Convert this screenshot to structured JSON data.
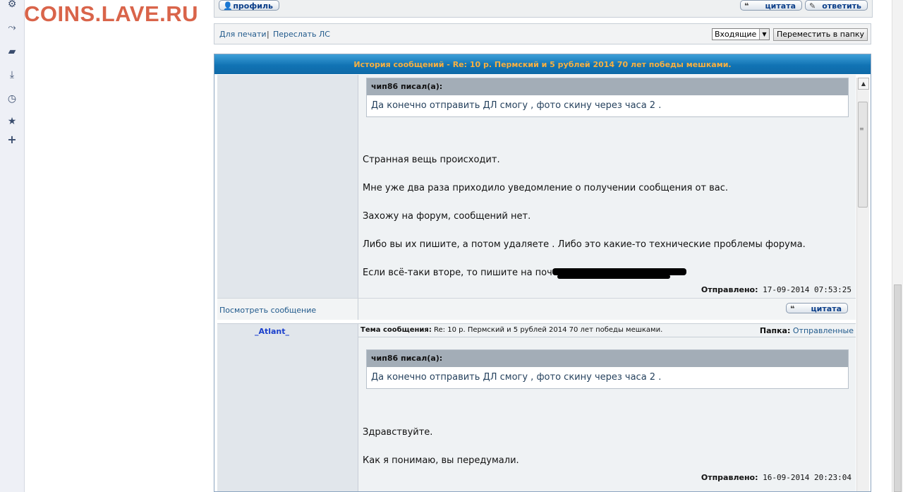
{
  "watermark": "COINS.LAVE.RU",
  "sidebar_icons": [
    "gear-icon",
    "share-icon",
    "note-icon",
    "download-icon",
    "clock-icon",
    "star-icon",
    "plus-icon"
  ],
  "top_buttons": {
    "profile": "профиль",
    "quote": "цитата",
    "reply": "ответить"
  },
  "toolbar": {
    "print_link": "Для печати",
    "separator": "|",
    "forward_link": "Переслать ЛС",
    "folder_select": "Входящие",
    "move_button": "Переместить в папку"
  },
  "history": {
    "title": "История сообщений - Re: 10 р. Пермский и 5 рублей 2014 70 лет победы мешками."
  },
  "message1": {
    "quote_header": "чип86 писал(а):",
    "quote_body": "Да конечно отправить ДЛ смогу , фото скину через часа 2 .",
    "lines": [
      "Странная вещь происходит.",
      "Мне уже два раза приходило уведомление о получении сообщения от вас.",
      "Захожу на форум, сообщений нет.",
      "Либо вы их пишите, а потом удаляете . Либо это какие-то технические проблемы форума.",
      "Если всё-таки вторе, то пишите на почту"
    ],
    "sent_label": "Отправлено:",
    "sent_date": "17-09-2014 07:53:25",
    "view_link": "Посмотреть сообщение",
    "quote_button": "цитата"
  },
  "message2": {
    "author": "_Atlant_",
    "subject_label": "Тема сообщения:",
    "subject": "Re: 10 р. Пермский и 5 рублей 2014 70 лет победы мешками.",
    "folder_label": "Папка:",
    "folder": "Отправленные",
    "quote_header": "чип86 писал(а):",
    "quote_body": "Да конечно отправить ДЛ смогу , фото скину через часа 2 .",
    "lines": [
      "Здравствуйте.",
      "Как я понимаю, вы передумали."
    ],
    "sent_label": "Отправлено:",
    "sent_date": "16-09-2014 20:23:04"
  }
}
